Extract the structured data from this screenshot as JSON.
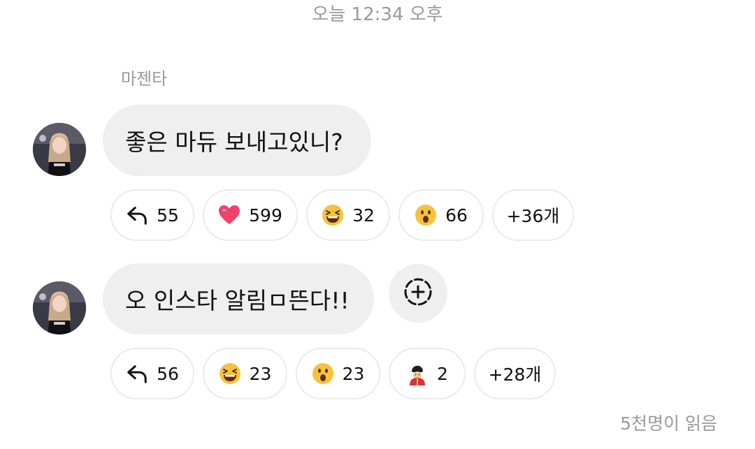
{
  "timestamp": "오늘 12:34 오후",
  "sender": {
    "name": "마젠타"
  },
  "messages": [
    {
      "text": "좋은 마듀 보내고있니?",
      "reactions": [
        {
          "icon": "reply-icon",
          "count": "55"
        },
        {
          "icon": "heart-emoji",
          "count": "599"
        },
        {
          "icon": "laughing-emoji",
          "count": "32"
        },
        {
          "icon": "surprised-emoji",
          "count": "66"
        }
      ],
      "more": "+36개"
    },
    {
      "text": "오 인스타 알림ㅁ뜬다!!",
      "reactions": [
        {
          "icon": "reply-icon",
          "count": "56"
        },
        {
          "icon": "laughing-emoji",
          "count": "23"
        },
        {
          "icon": "surprised-emoji",
          "count": "23"
        },
        {
          "icon": "guard-emoji",
          "count": "2"
        }
      ],
      "more": "+28개"
    }
  ],
  "read_receipt": "5천명이 읽음",
  "colors": {
    "bubble": "#efefef",
    "meta_text": "#9a9a9a",
    "chip_border": "#ebebeb",
    "heart": "#f0426b",
    "emoji_yellow": "#f7c23b"
  }
}
